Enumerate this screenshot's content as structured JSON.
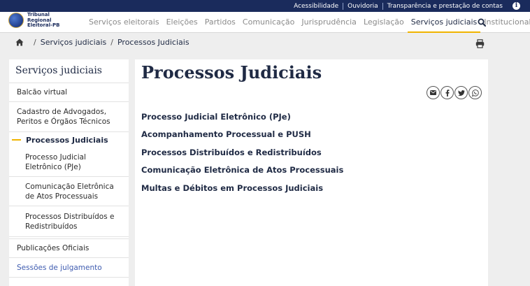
{
  "topbar": {
    "links": [
      "Acessibilidade",
      "Ouvidoria",
      "Transparência e prestação de contas"
    ]
  },
  "logo": {
    "lines": [
      "Tribunal",
      "Regional",
      "Eleitoral-PB"
    ]
  },
  "nav": {
    "items": [
      "Serviços eleitorais",
      "Eleições",
      "Partidos",
      "Comunicação",
      "Jurisprudência",
      "Legislação",
      "Serviços judiciais",
      "Institucional"
    ],
    "active_index": 6
  },
  "breadcrumb": {
    "items": [
      "Serviços judiciais",
      "Processos Judiciais"
    ],
    "separator": "/"
  },
  "sidebar": {
    "title": "Serviços judiciais",
    "items_top": [
      "Balcão virtual",
      "Cadastro de Advogados, Peritos e Órgãos Técnicos"
    ],
    "current": "Processos Judiciais",
    "subitems": [
      "Processo Judicial Eletrônico (PJe)",
      "Comunicação Eletrônica de Atos Processuais",
      "Processos Distribuídos e Redistribuídos"
    ],
    "items_bottom": [
      "Publicações Oficiais",
      "Sessões de julgamento"
    ]
  },
  "main": {
    "title": "Processos Judiciais",
    "share_icons": [
      "email-icon",
      "facebook-icon",
      "twitter-icon",
      "whatsapp-icon"
    ],
    "links": [
      "Processo Judicial Eletrônico (PJe)",
      "Acompanhamento Processual e PUSH",
      "Processos Distribuídos e Redistribuídos",
      "Comunicação Eletrônica de Atos Processuais",
      "Multas e Débitos em Processos Judiciais"
    ]
  },
  "colors": {
    "topbar_bg": "#1a2b5c",
    "accent": "#f0b400",
    "text_dark": "#1f2a44",
    "page_bg": "#eeeeee"
  }
}
